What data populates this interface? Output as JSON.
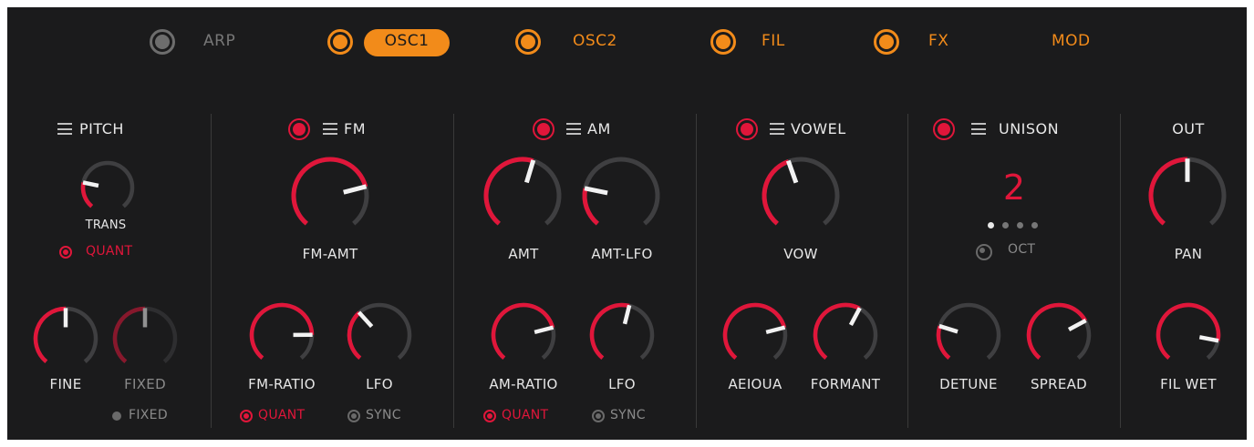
{
  "colors": {
    "accent_orange": "#f28b1a",
    "accent_red": "#e0163a",
    "track_grey": "#3f3f41",
    "panel_bg": "#1b1b1c"
  },
  "tabs": [
    {
      "label": "ARP",
      "enabled": false
    },
    {
      "label": "OSC1",
      "enabled": true,
      "selected": true
    },
    {
      "label": "OSC2",
      "enabled": true
    },
    {
      "label": "FIL",
      "enabled": true
    },
    {
      "label": "FX",
      "enabled": true
    },
    {
      "label": "MOD"
    }
  ],
  "pitch": {
    "title": "PITCH",
    "trans_label": "TRANS",
    "quant_label": "QUANT",
    "fine_label": "FINE",
    "fixed_label": "FIXED",
    "fixed_toggle_label": "FIXED"
  },
  "fm": {
    "title": "FM",
    "amt_label": "FM-AMT",
    "ratio_label": "FM-RATIO",
    "lfo_label": "LFO",
    "quant_label": "QUANT",
    "sync_label": "SYNC"
  },
  "am": {
    "title": "AM",
    "amt_label": "AMT",
    "amt_lfo_label": "AMT-LFO",
    "ratio_label": "AM-RATIO",
    "lfo_label": "LFO",
    "quant_label": "QUANT",
    "sync_label": "SYNC"
  },
  "vowel": {
    "title": "VOWEL",
    "vow_label": "VOW",
    "aeioua_label": "AEIOUA",
    "formant_label": "FORMANT"
  },
  "unison": {
    "title": "UNISON",
    "voices": "2",
    "oct_label": "OCT",
    "detune_label": "DETUNE",
    "spread_label": "SPREAD"
  },
  "out": {
    "title": "OUT",
    "pan_label": "PAN",
    "fil_wet_label": "FIL WET"
  },
  "knobs": {
    "trans": 0.22,
    "fm_amt": 0.77,
    "amt": 0.56,
    "amt_lfo": 0.22,
    "vow": 0.43,
    "pan": 0.5,
    "fine": 0.5,
    "fixed": 0.5,
    "fm_ratio": 0.82,
    "lfo_fm": 0.35,
    "am_ratio": 0.77,
    "lfo_am": 0.55,
    "aeioua": 0.77,
    "formant": 0.6,
    "detune": 0.24,
    "spread": 0.72,
    "fil_wet": 0.86
  }
}
